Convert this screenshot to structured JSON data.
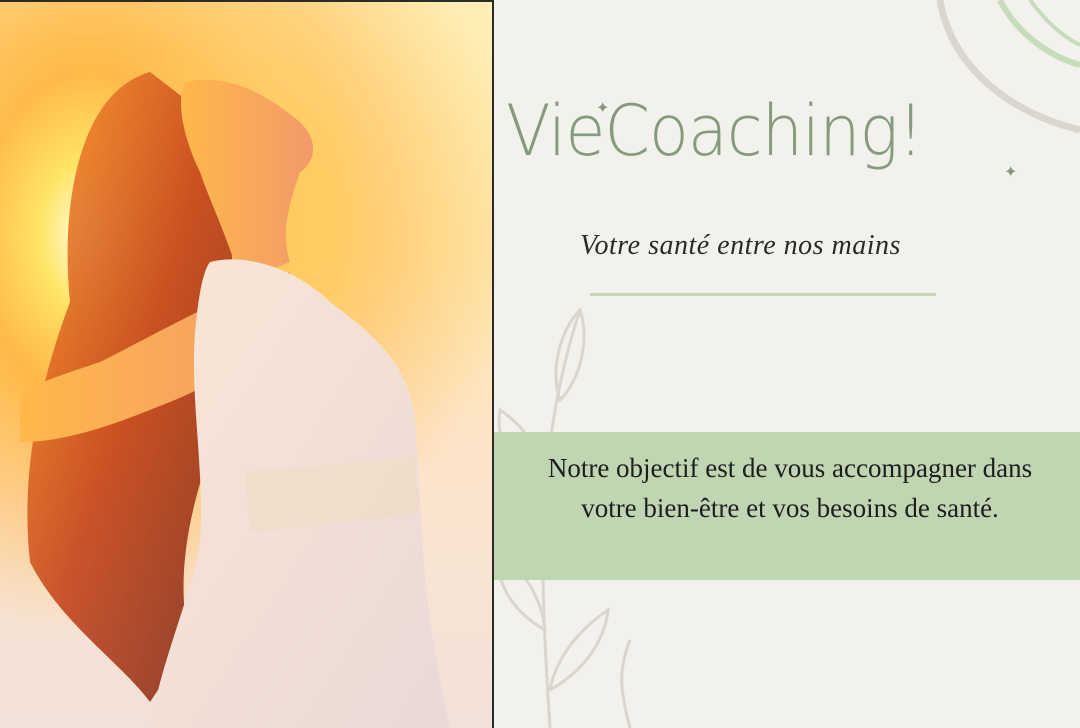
{
  "brand": {
    "name": "VieCoaching!",
    "tagline": "Votre santé entre nos mains"
  },
  "mission": {
    "text": "Notre objectif est de vous accompagner dans votre bien-être et vos besoins de santé."
  },
  "colors": {
    "background": "#f3f1ec",
    "brand_green": "#869a7e",
    "accent_green": "#c0d6b3",
    "divider_green": "#c3d6b8",
    "text_dark": "#1e1e1e"
  },
  "icons": [
    "sparkle-icon",
    "leaf-branch-decoration",
    "arc-decoration"
  ]
}
